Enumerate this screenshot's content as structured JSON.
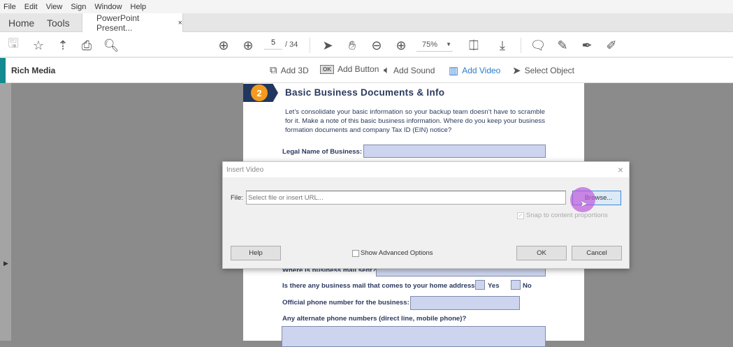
{
  "menu": [
    "File",
    "Edit",
    "View",
    "Sign",
    "Window",
    "Help"
  ],
  "tabs": {
    "home": "Home",
    "tools": "Tools",
    "document": "PowerPoint Present...",
    "close": "×"
  },
  "toolbar": {
    "page_current": "5",
    "page_total": "/ 34",
    "zoom": "75%"
  },
  "rich_media": {
    "title": "Rich Media",
    "buttons": [
      {
        "label": "Add 3D",
        "icon": "cube-icon"
      },
      {
        "label": "Add Button",
        "icon": "ok-button-icon",
        "glyph": "OK"
      },
      {
        "label": "Add Sound",
        "icon": "speaker-icon"
      },
      {
        "label": "Add Video",
        "icon": "film-icon",
        "active": true
      },
      {
        "label": "Select Object",
        "icon": "pointer-icon"
      }
    ],
    "active_color": "#2b7bd1"
  },
  "document": {
    "section_number": "2",
    "section_title": "Basic Business Documents & Info",
    "intro": "Let’s consolidate your basic information so your backup team doesn’t have to scramble for it. Make a note of this basic business information. Where do you keep your business formation documents and company Tax ID (EIN) notice?",
    "legal_name_label": "Legal Name of Business:",
    "mail_sent_label": "Where is business mail sent?",
    "home_mail_label": "Is there any business mail that comes to your home address?",
    "yes": "Yes",
    "no": "No",
    "phone_label": "Official phone number for the business:",
    "alt_phone_label": "Any alternate phone numbers (direct line, mobile phone)?"
  },
  "dialog": {
    "title": "Insert Video",
    "close": "×",
    "file_label": "File:",
    "file_placeholder": "Select file or insert URL...",
    "browse": "Browse...",
    "snap": "Snap to content proportions",
    "snap_checked": true,
    "help": "Help",
    "advanced": "Show Advanced Options",
    "advanced_checked": false,
    "ok": "OK",
    "cancel": "Cancel"
  }
}
